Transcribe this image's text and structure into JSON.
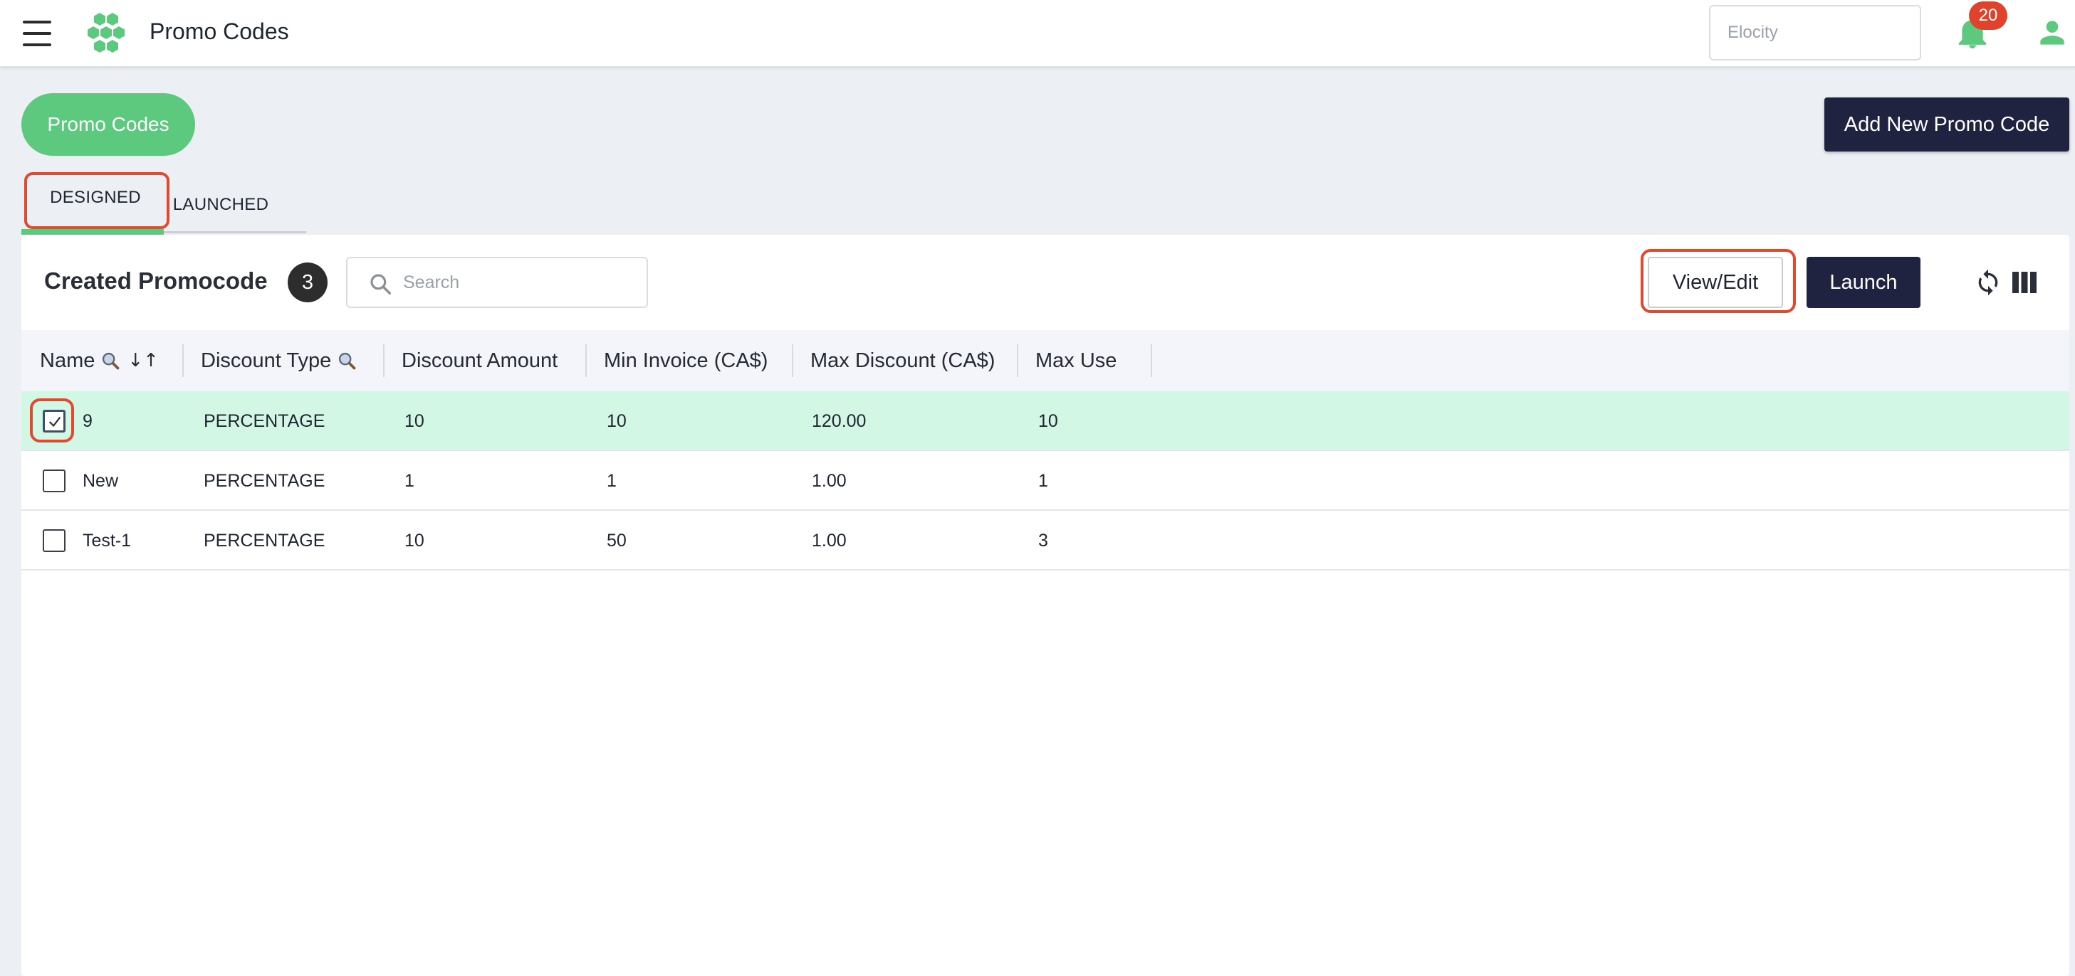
{
  "header": {
    "title": "Promo Codes",
    "org_placeholder": "Elocity",
    "notification_count": "20",
    "colors": {
      "brand_green": "#5cc97f",
      "navy": "#1f2340",
      "badge_red": "#e0432b"
    }
  },
  "page": {
    "pill_label": "Promo Codes",
    "add_button_label": "Add New Promo Code"
  },
  "tabs": [
    {
      "label": "DESIGNED",
      "active": true
    },
    {
      "label": "LAUNCHED",
      "active": false
    }
  ],
  "panel": {
    "title": "Created Promocode",
    "count": "3",
    "search_placeholder": "Search",
    "view_edit_label": "View/Edit",
    "launch_label": "Launch"
  },
  "table": {
    "columns": [
      "Name",
      "Discount Type",
      "Discount Amount",
      "Min Invoice (CA$)",
      "Max Discount (CA$)",
      "Max Use"
    ],
    "rows": [
      {
        "checked": true,
        "name": "9",
        "discount_type": "PERCENTAGE",
        "discount_amount": "10",
        "min_invoice": "10",
        "max_discount": "120.00",
        "max_use": "10"
      },
      {
        "checked": false,
        "name": "New",
        "discount_type": "PERCENTAGE",
        "discount_amount": "1",
        "min_invoice": "1",
        "max_discount": "1.00",
        "max_use": "1"
      },
      {
        "checked": false,
        "name": "Test-1",
        "discount_type": "PERCENTAGE",
        "discount_amount": "10",
        "min_invoice": "50",
        "max_discount": "1.00",
        "max_use": "3"
      }
    ]
  },
  "icons": [
    "menu-icon",
    "logo-icon",
    "bell-icon",
    "user-icon",
    "search-icon",
    "refresh-icon",
    "columns-icon",
    "column-search-icon",
    "sort-icon",
    "check-icon"
  ]
}
